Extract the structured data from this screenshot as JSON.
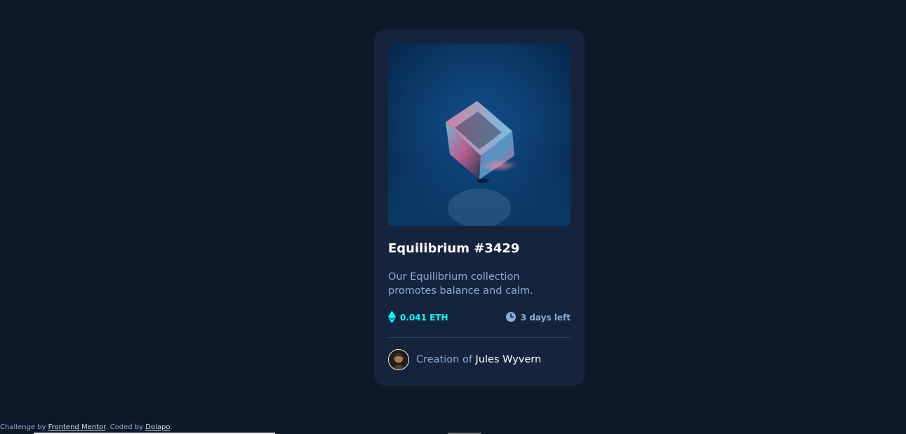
{
  "card": {
    "image_alt": "equilibrium",
    "title": "Equilibrium #3429",
    "description": "Our Equilibrium collection promotes balance and calm.",
    "price": "0.041 ETH",
    "time_left": "3 days left",
    "price_icon": "ethereum-icon",
    "time_icon": "clock-icon",
    "creator_prefix": "Creation of",
    "creator_name": "Jules Wyvern"
  },
  "footer": {
    "challenge_prefix": "Challenge by",
    "challenge_link": "Frontend Mentor",
    "coded_prefix": ". Coded by",
    "author_link": "Dolapo",
    "suffix": "."
  },
  "colors": {
    "page_background": "#0d1829",
    "card_background": "#15243c",
    "accent_cyan": "#00fff8",
    "soft_blue": "#8bacd9",
    "white": "#ffffff"
  }
}
